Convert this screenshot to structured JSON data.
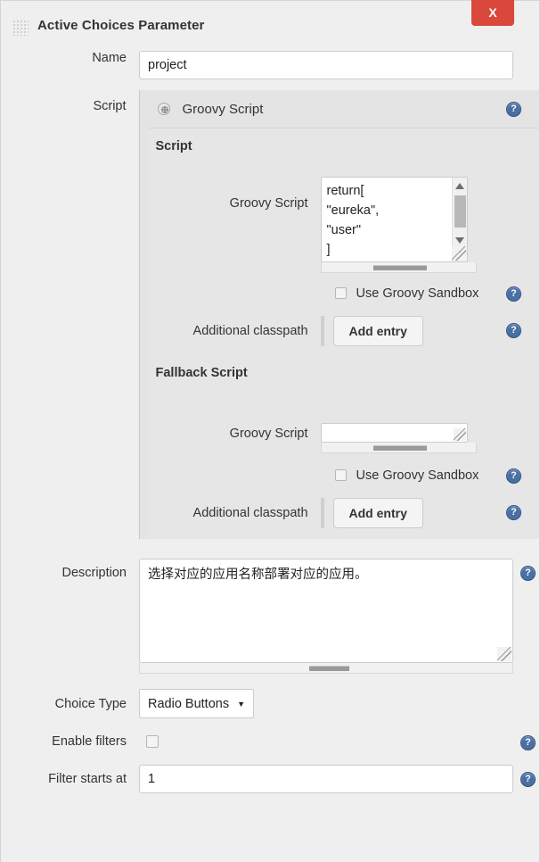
{
  "dialog": {
    "title": "Active Choices Parameter",
    "close_label": "X",
    "close_color": "#d9483b",
    "drag_handle_icon": "drag-grip-icon"
  },
  "help_icon": {
    "glyph": "?",
    "name": "help-icon",
    "color": "#4a6fa5"
  },
  "fields": {
    "name": {
      "label": "Name",
      "value": "project"
    },
    "script": {
      "label": "Script",
      "radio_label": "Groovy Script",
      "radio_selected": true,
      "main_section_title": "Script",
      "fallback_section_title": "Fallback Script",
      "groovy_script_label": "Groovy Script",
      "groovy_script_value": "return[\n\"eureka\",\n\"user\"\n]",
      "fallback_groovy_script_value": "",
      "sandbox_label": "Use Groovy Sandbox",
      "sandbox_checked": false,
      "classpath_label": "Additional classpath",
      "add_entry_label": "Add entry"
    },
    "description": {
      "label": "Description",
      "value": "选择对应的应用名称部署对应的应用。"
    },
    "choice_type": {
      "label": "Choice Type",
      "value": "Radio Buttons",
      "caret": "▼"
    },
    "enable_filters": {
      "label": "Enable filters",
      "checked": false
    },
    "filter_starts_at": {
      "label": "Filter starts at",
      "value": "1"
    }
  }
}
